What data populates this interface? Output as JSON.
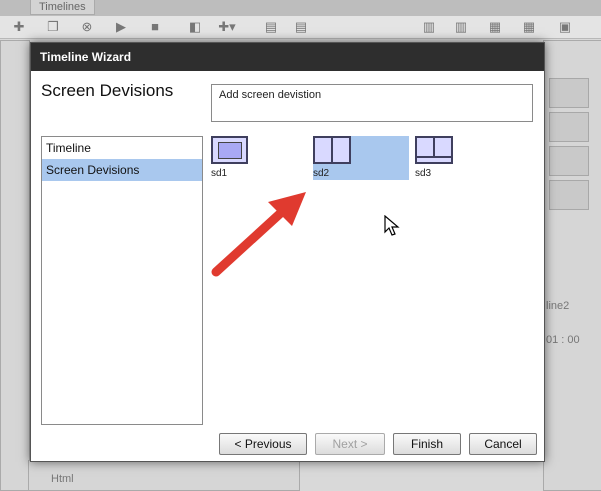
{
  "background": {
    "tab_label": "Timelines",
    "bottom_label": "Html",
    "side_text": "line2",
    "time_text": "01 : 00"
  },
  "dialog": {
    "title": "Timeline Wizard",
    "heading": "Screen Devisions",
    "description": "Add screen devistion",
    "nav_items": [
      {
        "label": "Timeline",
        "selected": false
      },
      {
        "label": "Screen Devisions",
        "selected": true
      }
    ],
    "layouts": [
      {
        "label": "sd1",
        "selected": false
      },
      {
        "label": "sd2",
        "selected": true
      },
      {
        "label": "sd3",
        "selected": false
      }
    ],
    "buttons": {
      "previous": "< Previous",
      "next": "Next >",
      "finish": "Finish",
      "cancel": "Cancel"
    }
  },
  "colors": {
    "selection": "#a9c8ee",
    "annotation_arrow": "#e03a2f",
    "titlebar": "#2e2e2e"
  }
}
